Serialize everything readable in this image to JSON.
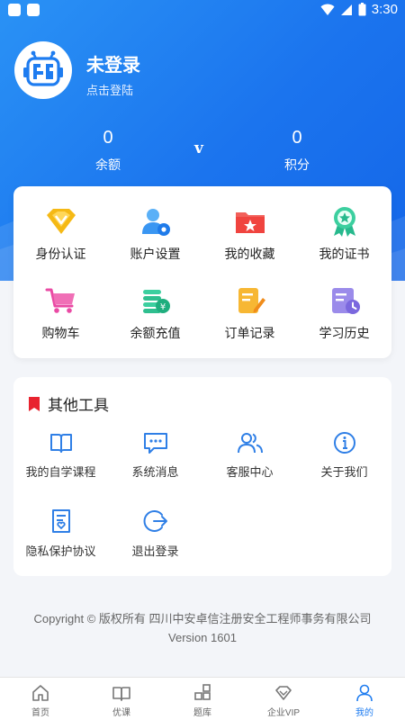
{
  "status_bar": {
    "time": "3:30"
  },
  "user": {
    "name": "未登录",
    "login_hint": "点击登陆"
  },
  "stats": {
    "balance": {
      "value": "0",
      "label": "余额"
    },
    "points": {
      "value": "0",
      "label": "积分"
    },
    "vip_mark": "v"
  },
  "main_menu": [
    {
      "label": "身份认证",
      "icon": "diamond-icon"
    },
    {
      "label": "账户设置",
      "icon": "user-gear-icon"
    },
    {
      "label": "我的收藏",
      "icon": "folder-star-icon"
    },
    {
      "label": "我的证书",
      "icon": "award-icon"
    },
    {
      "label": "购物车",
      "icon": "cart-icon"
    },
    {
      "label": "余额充值",
      "icon": "coin-recharge-icon"
    },
    {
      "label": "订单记录",
      "icon": "order-edit-icon"
    },
    {
      "label": "学习历史",
      "icon": "history-icon"
    }
  ],
  "tools": {
    "title": "其他工具",
    "items": [
      {
        "label": "我的自学课程",
        "icon": "open-book-icon"
      },
      {
        "label": "系统消息",
        "icon": "chat-icon"
      },
      {
        "label": "客服中心",
        "icon": "people-icon"
      },
      {
        "label": "关于我们",
        "icon": "info-icon"
      },
      {
        "label": "隐私保护协议",
        "icon": "document-heart-icon"
      },
      {
        "label": "退出登录",
        "icon": "logout-icon"
      }
    ]
  },
  "footer": {
    "copyright": "Copyright © 版权所有 四川中安卓信注册安全工程师事务有限公司",
    "version": "Version 1601"
  },
  "tabs": [
    {
      "label": "首页",
      "icon": "home-icon"
    },
    {
      "label": "优课",
      "icon": "book-icon"
    },
    {
      "label": "题库",
      "icon": "grid-icon"
    },
    {
      "label": "企业VIP",
      "icon": "vip-diamond-icon"
    },
    {
      "label": "我的",
      "icon": "person-icon",
      "active": true
    }
  ],
  "colors": {
    "primary": "#1e7cf0",
    "tools_marker": "#e8232f"
  }
}
